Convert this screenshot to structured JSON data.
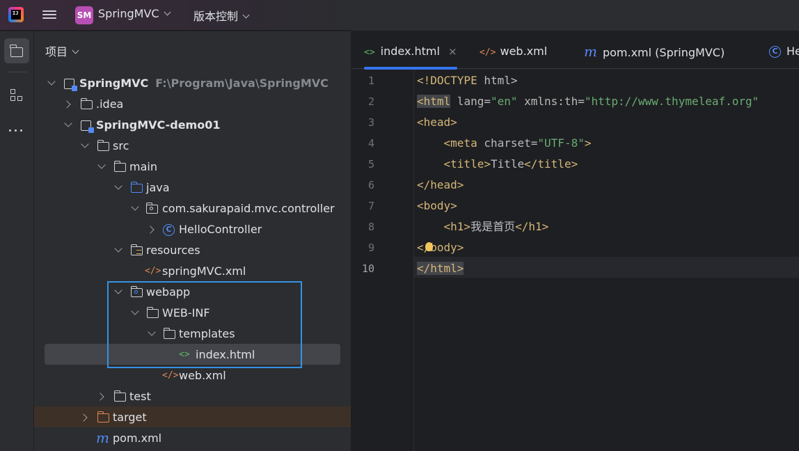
{
  "titlebar": {
    "project_badge": "SM",
    "project_name": "SpringMVC",
    "vcs_label": "版本控制"
  },
  "panel": {
    "title": "项目"
  },
  "tree": [
    {
      "label": "SpringMVC",
      "extra": "F:\\Program\\Java\\SpringMVC"
    },
    {
      "label": ".idea"
    },
    {
      "label": "SpringMVC-demo01"
    },
    {
      "label": "src"
    },
    {
      "label": "main"
    },
    {
      "label": "java"
    },
    {
      "label": "com.sakurapaid.mvc.controller"
    },
    {
      "label": "HelloController"
    },
    {
      "label": "resources"
    },
    {
      "label": "springMVC.xml"
    },
    {
      "label": "webapp"
    },
    {
      "label": "WEB-INF"
    },
    {
      "label": "templates"
    },
    {
      "label": "index.html"
    },
    {
      "label": "web.xml"
    },
    {
      "label": "test"
    },
    {
      "label": "target"
    },
    {
      "label": "pom.xml"
    }
  ],
  "tabs": [
    {
      "label": "index.html",
      "close": "×"
    },
    {
      "label": "web.xml"
    },
    {
      "label": "pom.xml (SpringMVC)"
    },
    {
      "label": "He"
    }
  ],
  "editor": {
    "line_numbers": [
      "1",
      "2",
      "3",
      "4",
      "5",
      "6",
      "7",
      "8",
      "9",
      "10"
    ],
    "lines": {
      "l1": {
        "tag": "<!DOCTYPE",
        "rest": " html>"
      },
      "l2": {
        "open": "<html",
        "attr1": " lang=",
        "val1": "\"en\"",
        "attr2": " xmlns:th=",
        "val2": "\"http://www.thymeleaf.org\""
      },
      "l3": {
        "tag": "<head>"
      },
      "l4": {
        "indent": "    ",
        "open": "<meta",
        "attr": " charset=",
        "val": "\"UTF-8\"",
        "close": ">"
      },
      "l5": {
        "indent": "    ",
        "open": "<title>",
        "text": "Title",
        "close": "</title>"
      },
      "l6": {
        "tag": "</head>"
      },
      "l7": {
        "tag": "<body>"
      },
      "l8": {
        "indent": "    ",
        "open": "<h1>",
        "text": "我是首页",
        "close": "</h1>"
      },
      "l9": {
        "tag": "</body>"
      },
      "l10": {
        "tag": "</html>"
      }
    }
  }
}
